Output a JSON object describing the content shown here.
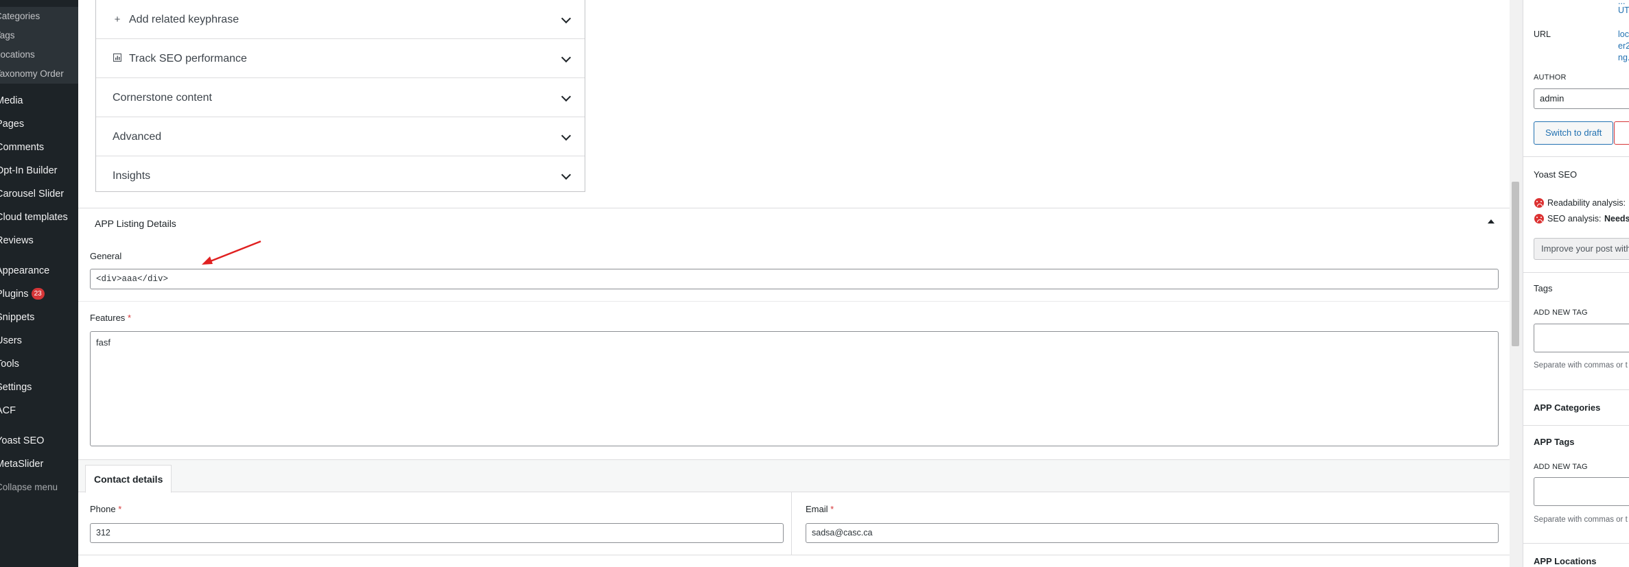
{
  "admin_menu": {
    "sub_items": [
      "Categories",
      "Tags",
      "Locations",
      "Taxonomy Order"
    ],
    "items": [
      {
        "label": "Media"
      },
      {
        "label": "Pages"
      },
      {
        "label": "Comments"
      },
      {
        "label": "Opt-In Builder"
      },
      {
        "label": "Carousel Slider"
      },
      {
        "label": "Cloud templates"
      },
      {
        "label": "Reviews"
      },
      {
        "label": "Appearance"
      },
      {
        "label": "Plugins",
        "badge": "23"
      },
      {
        "label": "Snippets"
      },
      {
        "label": "Users"
      },
      {
        "label": "Tools"
      },
      {
        "label": "Settings"
      },
      {
        "label": "ACF"
      },
      {
        "label": "Yoast SEO"
      },
      {
        "label": "MetaSlider"
      }
    ],
    "collapse_label": "Collapse menu"
  },
  "yoast_panel": {
    "rows": [
      {
        "label": "Add related keyphrase",
        "icon": "plus-icon"
      },
      {
        "label": "Track SEO performance",
        "icon": "chart-icon"
      },
      {
        "label": "Cornerstone content"
      },
      {
        "label": "Advanced"
      },
      {
        "label": "Insights"
      }
    ]
  },
  "app_listing": {
    "title": "APP Listing Details",
    "general_label": "General",
    "general_value": "<div>aaa</div>",
    "features_label": "Features",
    "features_value": "fasf",
    "required_mark": "*",
    "tab_label": "Contact details",
    "phone_label": "Phone",
    "phone_value": "312",
    "email_label": "Email",
    "email_value": "sadsa@casc.ca"
  },
  "sidebar": {
    "url_top_fragment": [
      "...",
      "UT"
    ],
    "url_label": "URL",
    "url_fragment": [
      "loc",
      "er2",
      "ng."
    ],
    "author_label": "AUTHOR",
    "author_value": "admin",
    "switch_to_draft": "Switch to draft",
    "yoast_title": "Yoast SEO",
    "readability_label": "Readability analysis:",
    "seo_label": "SEO analysis:",
    "seo_status": "Needs",
    "improve_label": "Improve your post with",
    "tags_title": "Tags",
    "add_new_tag": "ADD NEW TAG",
    "tags_help": "Separate with commas or t",
    "app_categories_title": "APP Categories",
    "app_tags_title": "APP Tags",
    "app_tags_add": "ADD NEW TAG",
    "app_tags_help": "Separate with commas or t",
    "app_locations_title": "APP Locations"
  },
  "colors": {
    "admin_bg": "#1d2327",
    "link": "#2271b1",
    "error": "#d63638",
    "annotation_arrow": "#e02020"
  }
}
